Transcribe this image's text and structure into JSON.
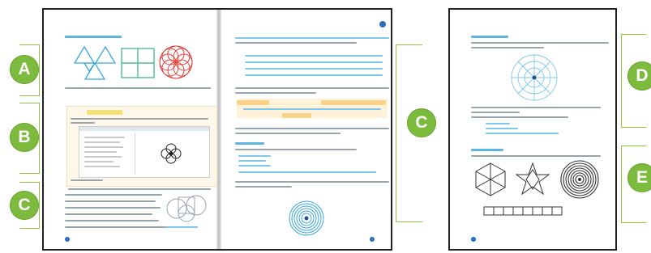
{
  "labels": {
    "a": "A",
    "b": "B",
    "c_left": "C",
    "c_right": "C",
    "d": "D",
    "e": "E"
  },
  "colors": {
    "bubble": "#7dbb3e",
    "bracket": "#8cc63f",
    "accent_blue": "#5cb6e3",
    "rose_red": "#e0403a",
    "page_border": "#222222"
  }
}
